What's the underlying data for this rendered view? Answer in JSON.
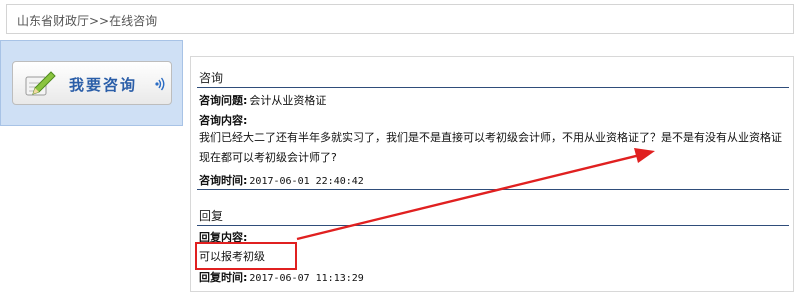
{
  "breadcrumb": {
    "text": "山东省财政厅>>在线咨询"
  },
  "consult_button": {
    "label": "我要咨询"
  },
  "question_section": {
    "title": "咨询",
    "subject_label": "咨询问题:",
    "subject_value": "会计从业资格证",
    "content_label": "咨询内容:",
    "content_text": "我们已经大二了还有半年多就实习了，我们是不是直接可以考初级会计师，不用从业资格证了？是不是有没有从业资格证现在都可以考初级会计师了?",
    "time_label": "咨询时间:",
    "time_value": "2017-06-01 22:40:42"
  },
  "reply_section": {
    "title": "回复",
    "content_label": "回复内容:",
    "content_text": "可以报考初级",
    "time_label": "回复时间:",
    "time_value": "2017-06-07 11:13:29"
  },
  "colors": {
    "annotation": "#e02020",
    "section_rule": "#2f4d7a",
    "button_text": "#2b5ea8",
    "left_panel_bg": "#cfe0f5"
  }
}
